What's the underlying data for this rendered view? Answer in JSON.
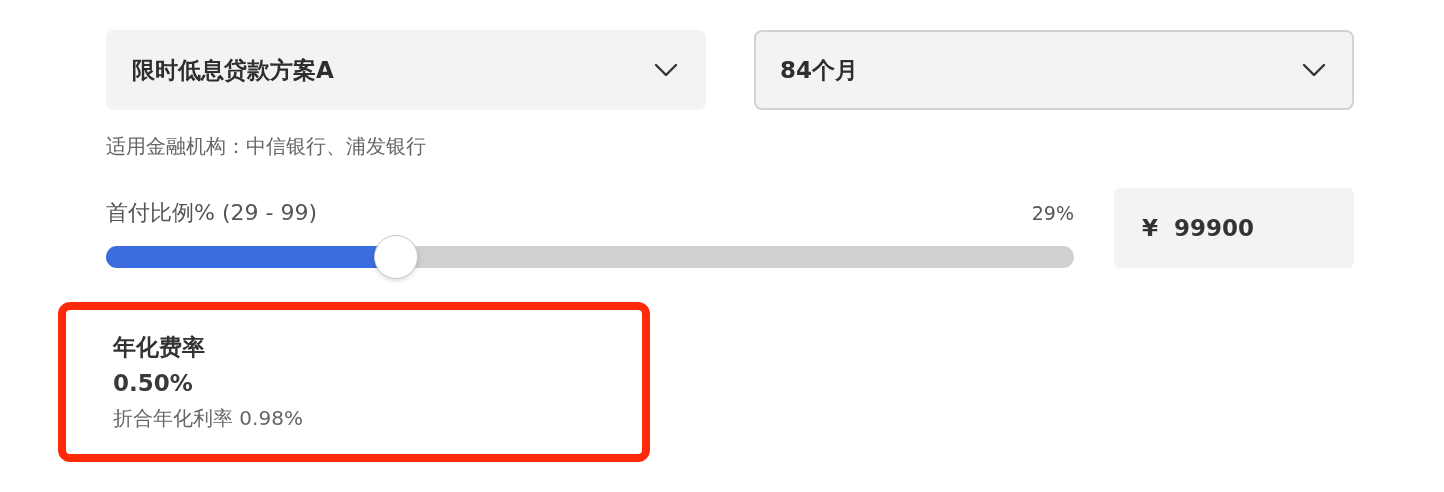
{
  "selects": [
    {
      "value": "限时低息贷款方案A",
      "focused": false
    },
    {
      "value": "84个月",
      "focused": true
    }
  ],
  "institutions_note": "适用金融机构：中信银行、浦发银行",
  "down_payment": {
    "label": "首付比例% (29 - 99)",
    "reading": "29%",
    "level": 0.3,
    "amount": "¥  99900"
  },
  "rate_card": {
    "highlighted": true,
    "title": "年化费率",
    "value": "0.50%",
    "note": "折合年化利率 0.98%"
  }
}
